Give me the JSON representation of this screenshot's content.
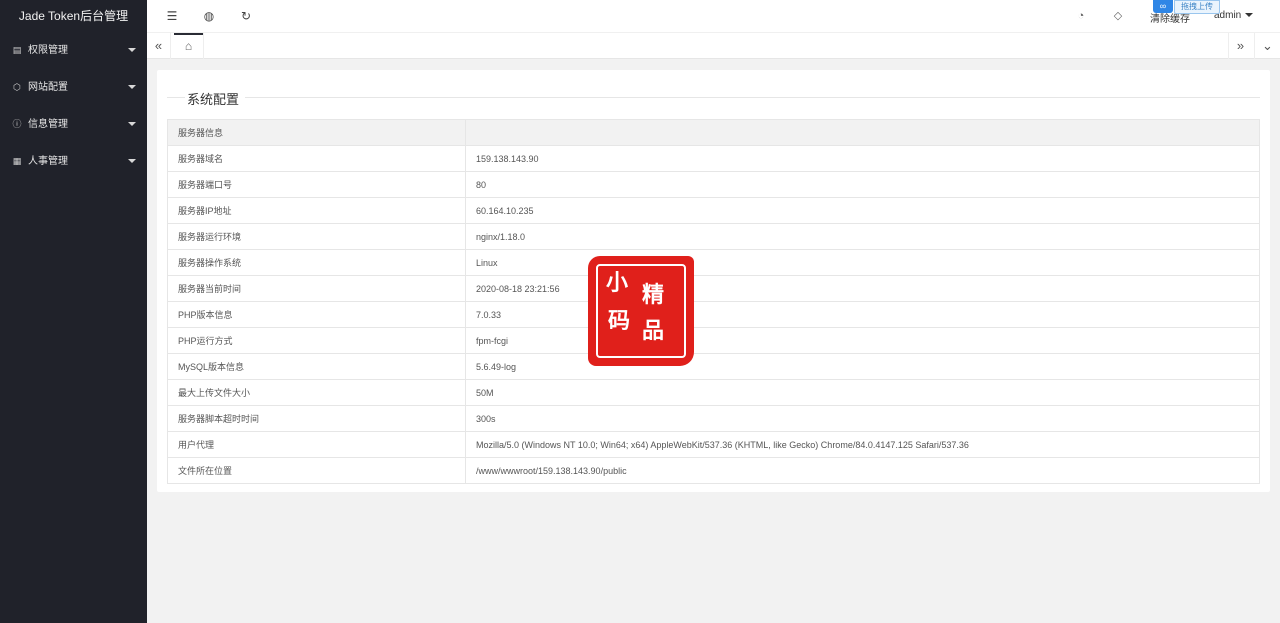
{
  "app": {
    "title": "Jade Token后台管理"
  },
  "sidebar": {
    "items": [
      {
        "icon": "bars-icon",
        "glyph": "▤",
        "label": "权限管理"
      },
      {
        "icon": "cube-icon",
        "glyph": "⬡",
        "label": "网站配置"
      },
      {
        "icon": "info-circle-icon",
        "glyph": "ⓘ",
        "label": "信息管理"
      },
      {
        "icon": "document-icon",
        "glyph": "▦",
        "label": "人事管理"
      }
    ]
  },
  "header": {
    "toggle_icon": "☰",
    "globe_icon": "◍",
    "refresh_icon": "↻",
    "theme_icon": "◔",
    "tag_icon": "◇",
    "clear_cache": "清除缓存",
    "user": "admin",
    "upload_label": "拖拽上传",
    "upload_logo": "∞"
  },
  "tabs": {
    "prev_icon": "«",
    "home_icon": "⌂",
    "next_icon": "»",
    "down_icon": "⌄"
  },
  "main": {
    "section_title": "系统配置",
    "header_row": "服务器信息",
    "rows": [
      {
        "key": "服务器域名",
        "value": "159.138.143.90"
      },
      {
        "key": "服务器端口号",
        "value": "80"
      },
      {
        "key": "服务器IP地址",
        "value": "60.164.10.235"
      },
      {
        "key": "服务器运行环境",
        "value": "nginx/1.18.0"
      },
      {
        "key": "服务器操作系统",
        "value": "Linux"
      },
      {
        "key": "服务器当前时间",
        "value": "2020-08-18 23:21:56"
      },
      {
        "key": "PHP版本信息",
        "value": "7.0.33"
      },
      {
        "key": "PHP运行方式",
        "value": "fpm-fcgi"
      },
      {
        "key": "MySQL版本信息",
        "value": "5.6.49-log"
      },
      {
        "key": "最大上传文件大小",
        "value": "50M"
      },
      {
        "key": "服务器脚本超时时间",
        "value": "300s"
      },
      {
        "key": "用户代理",
        "value": "Mozilla/5.0 (Windows NT 10.0; Win64; x64) AppleWebKit/537.36 (KHTML, like Gecko) Chrome/84.0.4147.125 Safari/537.36"
      },
      {
        "key": "文件所在位置",
        "value": "/www/wwwroot/159.138.143.90/public"
      }
    ]
  },
  "stamp": {
    "c1": "小",
    "c2": "精",
    "c3": "码",
    "c4": "品"
  },
  "colors": {
    "sidebar": "#20222a",
    "stamp": "#e0201b",
    "upload_accent": "#2f86e6"
  }
}
